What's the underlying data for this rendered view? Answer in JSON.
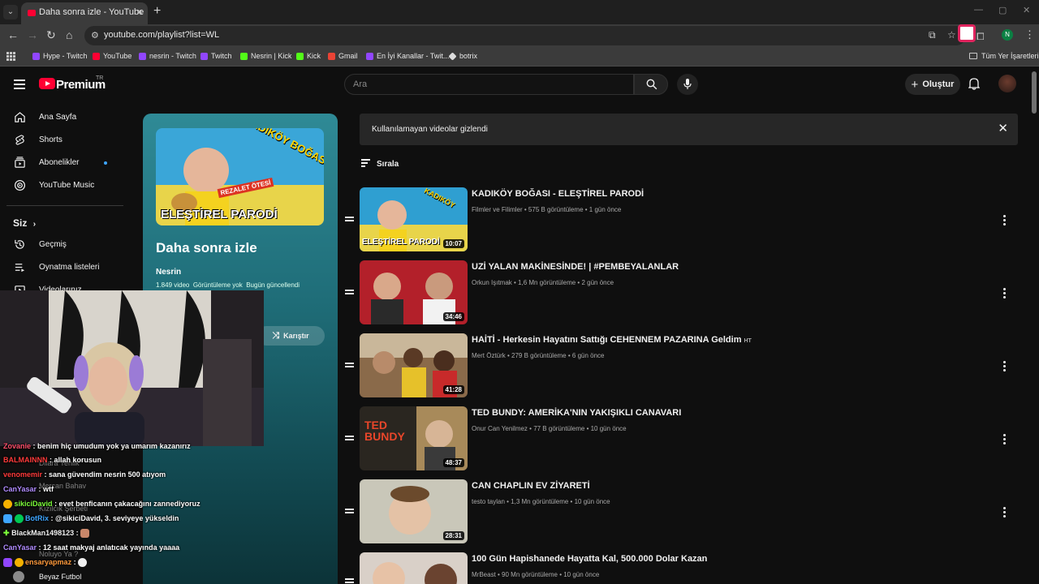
{
  "browser": {
    "tab_title": "Daha sonra izle - YouTube",
    "url": "youtube.com/playlist?list=WL",
    "profile_initial": "N",
    "bookmarks": [
      {
        "label": "Hype - Twitch",
        "color": "#9146ff"
      },
      {
        "label": "YouTube",
        "color": "#ff0033"
      },
      {
        "label": "nesrin - Twitch",
        "color": "#9146ff"
      },
      {
        "label": "Twitch",
        "color": "#9146ff"
      },
      {
        "label": "Nesrin | Kick",
        "color": "#53fc18"
      },
      {
        "label": "Kick",
        "color": "#53fc18"
      },
      {
        "label": "Gmail",
        "color": "#ea4335"
      },
      {
        "label": "En İyi Kanallar - Twit...",
        "color": "#9146ff"
      },
      {
        "label": "botrix",
        "color": "#dddddd"
      }
    ],
    "all_bookmarks": "Tüm Yer İşaretleri"
  },
  "header": {
    "brand": "Premium",
    "region": "TR",
    "search_placeholder": "Ara",
    "create_label": "Oluştur"
  },
  "sidebar": {
    "items": [
      {
        "label": "Ana Sayfa",
        "icon": "home-icon"
      },
      {
        "label": "Shorts",
        "icon": "shorts-icon"
      },
      {
        "label": "Abonelikler",
        "icon": "subscriptions-icon"
      },
      {
        "label": "YouTube Music",
        "icon": "music-icon"
      }
    ],
    "you_section": "Siz",
    "you_items": [
      {
        "label": "Geçmiş",
        "icon": "history-icon"
      },
      {
        "label": "Oynatma listeleri",
        "icon": "playlists-icon"
      },
      {
        "label": "Videolarınız",
        "icon": "your-videos-icon"
      }
    ],
    "bottom_item": "Beyaz Futbol"
  },
  "playlist": {
    "title": "Daha sonra izle",
    "owner": "Nesrin",
    "video_count": "1.849 video",
    "views": "Görüntüleme yok",
    "updated": "Bugün güncellendi",
    "shuffle_label": "Karıştır",
    "thumb_text_main": "ELEŞTİREL PARODİ",
    "thumb_text_top": "KADIKÖY BOĞASI",
    "thumb_badge": "REZALET ÖTESİ"
  },
  "main": {
    "banner_text": "Kullanılamayan videolar gizlendi",
    "sort_label": "Sırala",
    "videos": [
      {
        "title": "KADIKÖY BOĞASI - ELEŞTİREL PARODİ",
        "badge": "",
        "channel": "Filmler ve Filimler",
        "views": "575 B görüntüleme",
        "age": "1 gün önce",
        "duration": "10:07",
        "bg": "#2f9fd1"
      },
      {
        "title": "UZİ YALAN MAKİNESİNDE! | #PEMBEYALANLAR",
        "badge": "",
        "channel": "Orkun Işıtmak",
        "views": "1,6 Mn görüntüleme",
        "age": "2 gün önce",
        "duration": "34:46",
        "bg": "#b3202a"
      },
      {
        "title": "HAİTİ - Herkesin Hayatını Sattığı CEHENNEM PAZARINA Geldim",
        "badge": "HT",
        "channel": "Mert Öztürk",
        "views": "279 B görüntüleme",
        "age": "6 gün önce",
        "duration": "41:28",
        "bg": "#8a6a4a"
      },
      {
        "title": "TED BUNDY: AMERİKA'NIN YAKIŞIKLI CANAVARI",
        "badge": "",
        "channel": "Onur Can Yenilmez",
        "views": "77 B görüntüleme",
        "age": "10 gün önce",
        "duration": "48:37",
        "bg": "#2a2620"
      },
      {
        "title": "CAN CHAPLIN EV ZİYARETİ",
        "badge": "",
        "channel": "testo taylan",
        "views": "1,3 Mn görüntüleme",
        "age": "10 gün önce",
        "duration": "28:31",
        "bg": "#c9c7b9"
      },
      {
        "title": "100 Gün Hapishanede Hayatta Kal, 500.000 Dolar Kazan",
        "badge": "",
        "channel": "MrBeast",
        "views": "90 Mn görüntüleme",
        "age": "10 gün önce",
        "duration": "",
        "bg": "#d9d0c8"
      }
    ]
  },
  "stream": {
    "chat": [
      {
        "user": "Zovanie",
        "color": "#ff4f6b",
        "text": ": benim hiç umudum yok ya umarım kazanırız"
      },
      {
        "user": "BALMAINNN",
        "color": "#ff3b3b",
        "text": ": allah korusun"
      },
      {
        "user": "venomemir",
        "color": "#ff3b3b",
        "text": ": sana güvendim nesrin 500 atıyom"
      },
      {
        "user": "CanYasar",
        "color": "#b18cff",
        "text": ": wtf"
      },
      {
        "user": "sikiciDavid",
        "color": "#7cfc3a",
        "text": ": evet benficanın çakacağını zannediyoruz"
      },
      {
        "user": "BotRix",
        "color": "#3ea6ff",
        "text": ": @sikiciDavid, 3. seviyeye yükseldin"
      },
      {
        "user": "BlackMan1498123",
        "color": "#f1f1f1",
        "text": ":"
      },
      {
        "user": "CanYasar",
        "color": "#b18cff",
        "text": ": 12 saat makyaj anlatıcak yayında yaaaa"
      },
      {
        "user": "ensaryapmaz",
        "color": "#ff9a3c",
        "text": ":"
      }
    ],
    "subs_under": [
      "Dilara Yenlik",
      "Mercan Bahav",
      "Kızılcık Şerbeti",
      "Noluyo Ya ?"
    ]
  }
}
